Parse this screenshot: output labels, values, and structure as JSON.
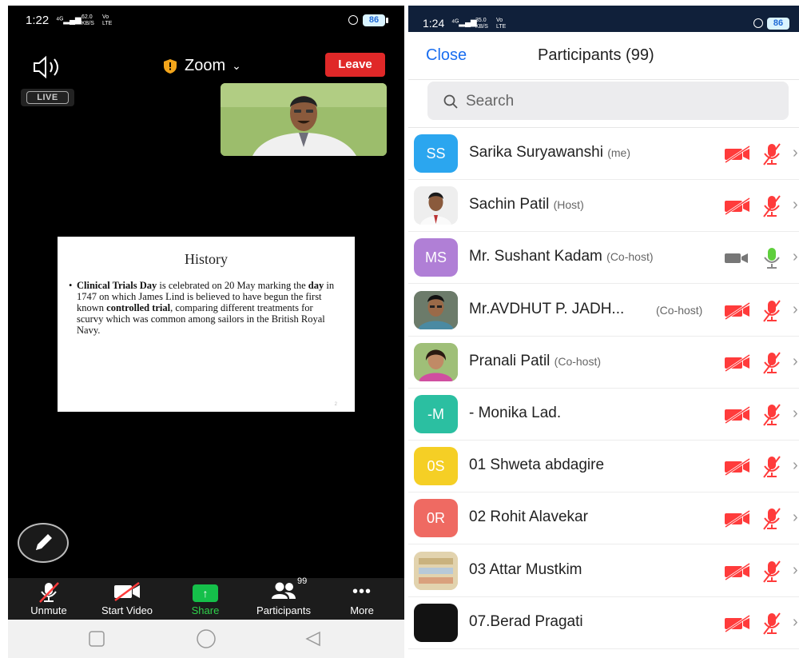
{
  "left": {
    "status": {
      "time": "1:22",
      "net_top": "62.0",
      "net_bottom": "KB/S",
      "net_label_top": "Vo",
      "net_label_bottom": "LTE",
      "battery": "86"
    },
    "header": {
      "title": "Zoom",
      "leave_label": "Leave",
      "live_label": "LIVE"
    },
    "slide": {
      "title": "History",
      "body": [
        {
          "text": "Clinical Trials Day",
          "bold": true
        },
        {
          "text": " is celebrated on 20 May marking the ",
          "bold": false
        },
        {
          "text": "day",
          "bold": true
        },
        {
          "text": " in 1747 on which James Lind is believed to have begun the first known ",
          "bold": false
        },
        {
          "text": "controlled trial",
          "bold": true
        },
        {
          "text": ", comparing different treatments for scurvy which was common among sailors in the British Royal Navy.",
          "bold": false
        }
      ],
      "page_number": "2"
    },
    "toolbar": {
      "unmute": "Unmute",
      "start_video": "Start Video",
      "share": "Share",
      "participants": "Participants",
      "participants_count": "99",
      "more": "More"
    },
    "colors": {
      "leave": "#e02828",
      "share": "#15c04a",
      "mute_red": "#ff3b3b"
    }
  },
  "right": {
    "status": {
      "time": "1:24",
      "net_top": "35.0",
      "net_bottom": "KB/S",
      "net_label_top": "Vo",
      "net_label_bottom": "LTE",
      "battery": "86"
    },
    "header": {
      "close_label": "Close",
      "title": "Participants (99)"
    },
    "search": {
      "placeholder": "Search"
    },
    "participants": [
      {
        "initials": "SS",
        "avatar_color": "#2ba6ef",
        "name": "Sarika Suryawanshi",
        "role": "(me)",
        "muted": true,
        "video_off": true
      },
      {
        "initials": "",
        "avatar_color": "#e9e9e9",
        "photo": "doctor",
        "name": "Sachin Patil",
        "role": "(Host)",
        "muted": true,
        "video_off": true
      },
      {
        "initials": "MS",
        "avatar_color": "#b07fd6",
        "name": "Mr. Sushant Kadam",
        "role": "(Co-host)",
        "muted": false,
        "video_off": false
      },
      {
        "initials": "",
        "avatar_color": "#5a6b57",
        "photo": "man",
        "name": "Mr.AVDHUT P. JADH...",
        "role": "(Co-host)",
        "muted": true,
        "video_off": true
      },
      {
        "initials": "",
        "avatar_color": "#a8b97e",
        "photo": "woman",
        "name": "Pranali Patil",
        "role": "(Co-host)",
        "muted": true,
        "video_off": true
      },
      {
        "initials": "-M",
        "avatar_color": "#2bbfa1",
        "name": "- Monika Lad.",
        "role": "",
        "muted": true,
        "video_off": true
      },
      {
        "initials": "0S",
        "avatar_color": "#f5cf25",
        "name": "01 Shweta abdagire",
        "role": "",
        "muted": true,
        "video_off": true
      },
      {
        "initials": "0R",
        "avatar_color": "#ef6a62",
        "name": "02 Rohit Alavekar",
        "role": "",
        "muted": true,
        "video_off": true
      },
      {
        "initials": "",
        "avatar_color": "#d8c9a5",
        "photo": "poster",
        "name": "03 Attar Mustkim",
        "role": "",
        "muted": true,
        "video_off": true
      },
      {
        "initials": "",
        "avatar_color": "#121212",
        "name": "07.Berad Pragati",
        "role": "",
        "muted": true,
        "video_off": true
      }
    ],
    "colors": {
      "link": "#1a6ef0",
      "muted_red": "#ff3b3b",
      "mic_green": "#5fcf3c",
      "cam_gray": "#777777"
    }
  }
}
